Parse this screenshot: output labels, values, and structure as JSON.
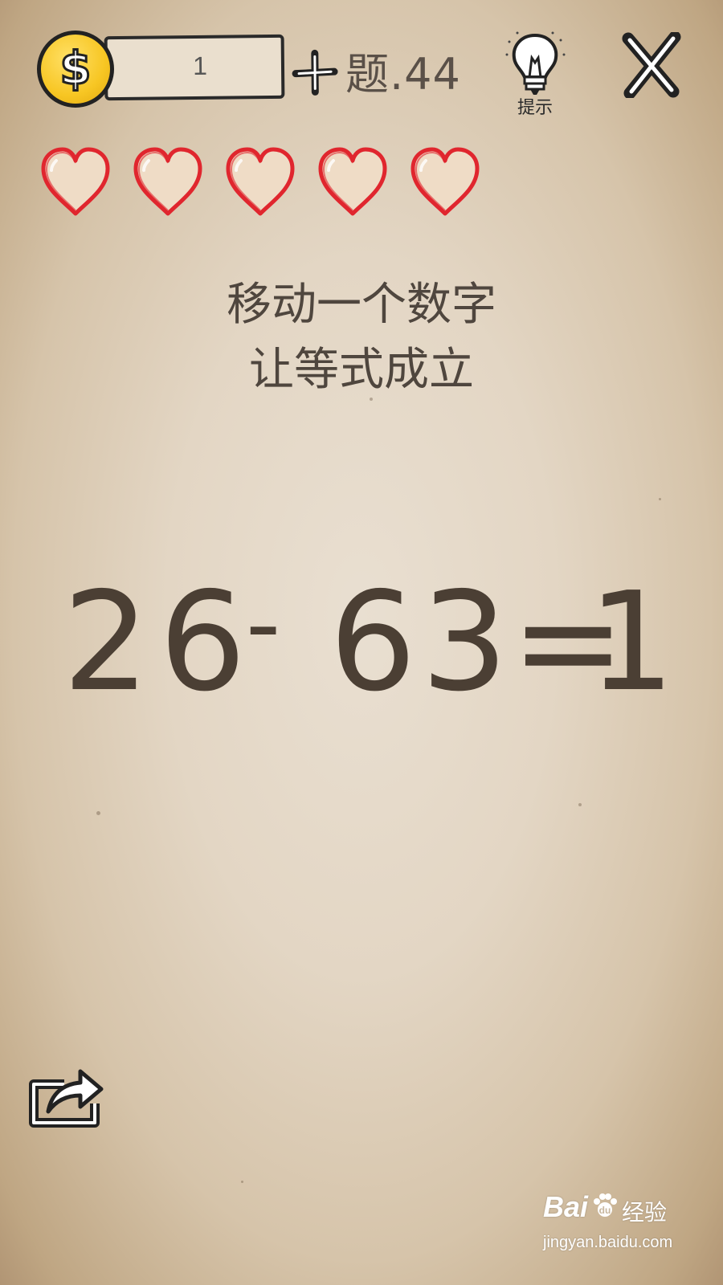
{
  "header": {
    "coin_symbol": "$",
    "coin_count": "1",
    "level_title": "题.44",
    "hint_label": "提示"
  },
  "lives": {
    "total": 5,
    "remaining": 5,
    "heart_color": "#e0262e",
    "heart_fill": "#efdcc6"
  },
  "puzzle": {
    "instruction_line1": "移动一个数字",
    "instruction_line2": "让等式成立",
    "equation": {
      "left_number": "26",
      "operator": "-",
      "right_number": "63",
      "equals": "=",
      "result": "1"
    }
  },
  "watermark": {
    "brand": "Bai",
    "brand_cn": "经验",
    "url": "jingyan.baidu.com"
  },
  "colors": {
    "coin": "#f7c623",
    "text": "#4b3f34",
    "outline": "#222222"
  }
}
